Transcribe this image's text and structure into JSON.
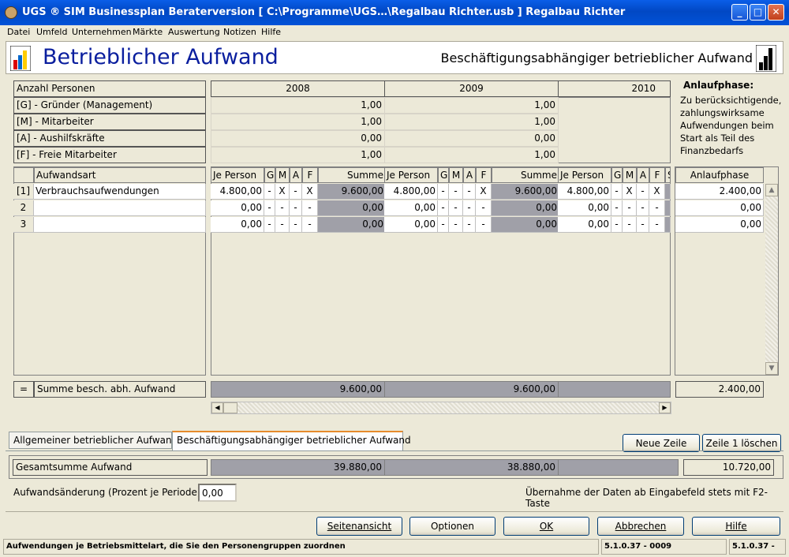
{
  "window": {
    "title": "UGS ® SIM Businessplan Beraterversion    [ C:\\Programme\\UGS…\\Regalbau Richter.usb ] Regalbau Richter",
    "minimize": "_",
    "maximize": "□",
    "close": "✕"
  },
  "menu": [
    "Datei",
    "Umfeld",
    "Unternehmen",
    "Märkte",
    "Auswertung",
    "Notizen",
    "Hilfe"
  ],
  "header": {
    "title": "Betrieblicher Aufwand",
    "subtitle": "Beschäftigungsabhängiger betrieblicher Aufwand"
  },
  "persons": {
    "label": "Anzahl Personen",
    "years": [
      "2008",
      "2009",
      "2010"
    ],
    "rows": [
      {
        "label": "[G] - Gründer (Management)",
        "values": [
          "1,00",
          "1,00",
          ""
        ]
      },
      {
        "label": "[M] - Mitarbeiter",
        "values": [
          "1,00",
          "1,00",
          ""
        ]
      },
      {
        "label": "[A] - Aushilfskräfte",
        "values": [
          "0,00",
          "0,00",
          ""
        ]
      },
      {
        "label": "[F] - Freie Mitarbeiter",
        "values": [
          "1,00",
          "1,00",
          ""
        ]
      }
    ]
  },
  "info": {
    "title": "Anlaufphase:",
    "text": "Zu berücksichtigende, zahlungswirksame Aufwendungen beim Start als Teil des Finanzbedarfs"
  },
  "grid": {
    "col_aufwandsart": "Aufwandsart",
    "col_jeperson": "Je Person",
    "flags": [
      "G",
      "M",
      "A",
      "F"
    ],
    "col_summe": "Summe",
    "col_anlauf": "Anlaufphase",
    "rows": [
      {
        "idx": "[1]",
        "name": "Verbrauchsaufwendungen",
        "years": [
          {
            "je": "4.800,00",
            "f": [
              "-",
              "X",
              "-",
              "X"
            ],
            "sum": "9.600,00"
          },
          {
            "je": "4.800,00",
            "f": [
              "-",
              "-",
              "-",
              "X"
            ],
            "sum": "9.600,00"
          },
          {
            "je": "4.800,00",
            "f": [
              "-",
              "X",
              "-",
              "X"
            ]
          }
        ],
        "anlauf": "2.400,00"
      },
      {
        "idx": "2",
        "name": "",
        "years": [
          {
            "je": "0,00",
            "f": [
              "-",
              "-",
              "-",
              "-"
            ],
            "sum": "0,00"
          },
          {
            "je": "0,00",
            "f": [
              "-",
              "-",
              "-",
              "-"
            ],
            "sum": "0,00"
          },
          {
            "je": "0,00",
            "f": [
              "-",
              "-",
              "-",
              "-"
            ]
          }
        ],
        "anlauf": "0,00"
      },
      {
        "idx": "3",
        "name": "",
        "years": [
          {
            "je": "0,00",
            "f": [
              "-",
              "-",
              "-",
              "-"
            ],
            "sum": "0,00"
          },
          {
            "je": "0,00",
            "f": [
              "-",
              "-",
              "-",
              "-"
            ],
            "sum": "0,00"
          },
          {
            "je": "0,00",
            "f": [
              "-",
              "-",
              "-",
              "-"
            ]
          }
        ],
        "anlauf": "0,00"
      }
    ]
  },
  "summe": {
    "eq": "=",
    "label": "Summe besch. abh. Aufwand",
    "values": [
      "9.600,00",
      "9.600,00",
      ""
    ],
    "anlauf": "2.400,00"
  },
  "tabs": [
    "Allgemeiner betrieblicher Aufwand",
    "Beschäftigungsabhängiger betrieblicher Aufwand"
  ],
  "buttons": {
    "neue_zeile": "Neue Zeile",
    "zeile_loeschen": "Zeile 1 löschen",
    "seitenansicht": "Seitenansicht",
    "optionen": "Optionen",
    "ok": "OK",
    "abbrechen": "Abbrechen",
    "hilfe": "Hilfe"
  },
  "gesamt": {
    "label": "Gesamtsumme Aufwand",
    "values": [
      "39.880,00",
      "38.880,00",
      ""
    ],
    "anlauf": "10.720,00"
  },
  "aenderung": {
    "label": "Aufwandsänderung (Prozent je Periode)",
    "value": "0,00"
  },
  "hint": "Übernahme der Daten ab Eingabefeld stets mit F2-Taste",
  "status": {
    "text": "Aufwendungen je Betriebsmittelart, die Sie den Personengruppen zuordnen",
    "ver1": "5.1.0.37 - 0009",
    "ver2": "5.1.0.37 -"
  }
}
